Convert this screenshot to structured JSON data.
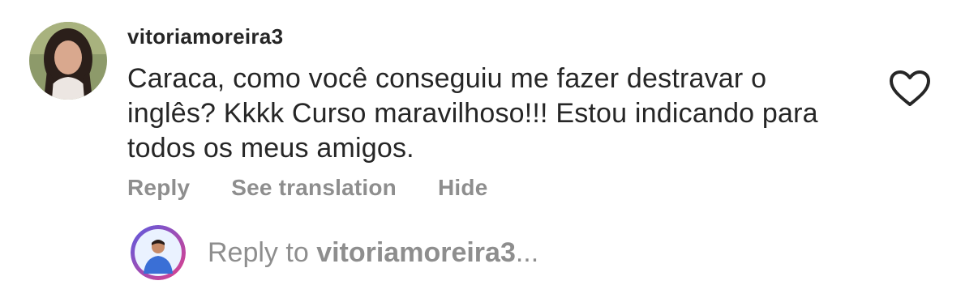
{
  "comment": {
    "username": "vitoriamoreira3",
    "text": "Caraca, como você conseguiu me fazer destravar o inglês? Kkkk Curso maravilhoso!!! Estou indicando para todos os meus amigos.",
    "actions": {
      "reply": "Reply",
      "see_translation": "See translation",
      "hide": "Hide"
    },
    "like_icon": "heart-outline-icon"
  },
  "reply_composer": {
    "prefix": "Reply to ",
    "target": "vitoriamoreira3",
    "suffix": "..."
  },
  "colors": {
    "text": "#262626",
    "secondary": "#8e8e8e",
    "avatar_ring_start": "#5b5be0",
    "avatar_ring_end": "#e0408a"
  }
}
